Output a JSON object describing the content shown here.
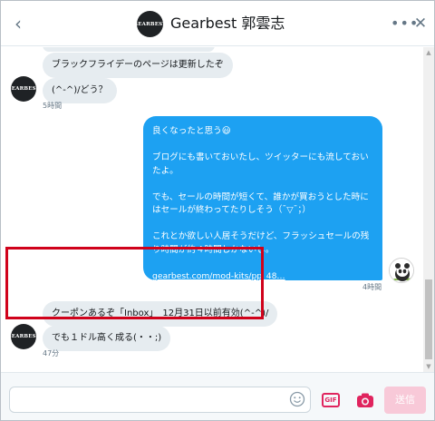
{
  "header": {
    "title": "Gearbest 郭雲志",
    "logo_text": "GEARBEST",
    "back_icon": "‹",
    "more_icon": "•••",
    "close_icon": "✕"
  },
  "messages": {
    "incoming_top": [
      {
        "text": "ブラックフライデーのページは更新したぞ"
      },
      {
        "text": "(^-^)/どう？"
      }
    ],
    "time_1": "5時間",
    "outgoing": {
      "paragraphs": [
        "良くなったと思う😃",
        "ブログにも書いておいたし、ツイッターにも流しておいたよ。",
        "でも、セールの時間が短くて、誰かが買おうとした時にはセールが終わってたりしそう（¯▽¯；）",
        "これとか欲しい人居そうだけど、フラッシュセールの残り時間が約４時間しかないし。"
      ],
      "link": "gearbest.com/mod-kits/pp_48…"
    },
    "time_2": "4時間",
    "incoming_bottom": [
      {
        "text": "クーポンあるぞ「Inbox」　12月31日以前有効(^-^)/"
      },
      {
        "text": "でも１ドル高く成る(・・;)"
      }
    ],
    "time_3": "47分"
  },
  "composer": {
    "input_value": "",
    "gif_label": "GIF",
    "send_label": "送信"
  },
  "colors": {
    "accent": "#1da1f2",
    "highlight": "#d0021b",
    "send_disabled": "#f8c9d8",
    "icon_pink": "#e0245e"
  }
}
